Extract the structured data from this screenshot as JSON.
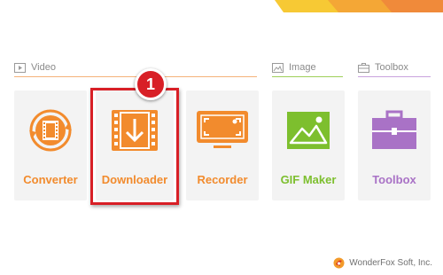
{
  "sections": {
    "video": {
      "label": "Video"
    },
    "image": {
      "label": "Image"
    },
    "toolbox": {
      "label": "Toolbox"
    }
  },
  "tools": [
    {
      "label": "Converter",
      "icon": "film-convert-icon",
      "color": "#f28b2d"
    },
    {
      "label": "Downloader",
      "icon": "download-icon",
      "color": "#f28b2d"
    },
    {
      "label": "Recorder",
      "icon": "screen-record-icon",
      "color": "#f28b2d"
    },
    {
      "label": "GIF Maker",
      "icon": "image-icon",
      "color": "#7dbf2e"
    },
    {
      "label": "Toolbox",
      "icon": "toolbox-icon",
      "color": "#a972c6"
    }
  ],
  "annotation": {
    "step": "1",
    "color": "#d81f26"
  },
  "footer": {
    "brand": "WonderFox Soft, Inc."
  }
}
